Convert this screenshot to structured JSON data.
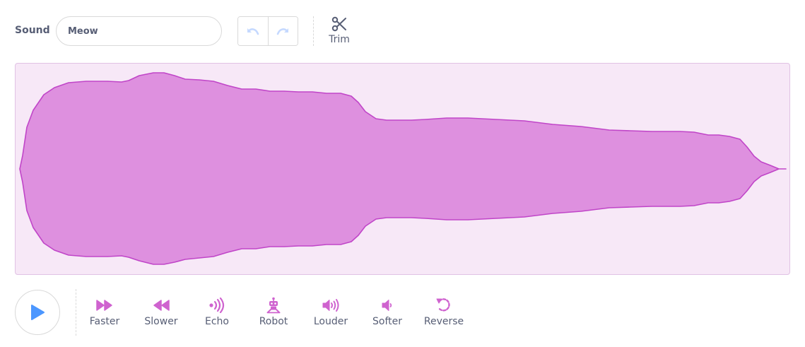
{
  "header": {
    "sound_label": "Sound",
    "sound_name": "Meow",
    "trim_label": "Trim"
  },
  "icons": {
    "undo": "undo-icon",
    "redo": "redo-icon",
    "trim": "scissors-icon",
    "play": "play-icon"
  },
  "effects": [
    {
      "label": "Faster",
      "icon": "fast-forward-icon"
    },
    {
      "label": "Slower",
      "icon": "rewind-icon"
    },
    {
      "label": "Echo",
      "icon": "echo-icon"
    },
    {
      "label": "Robot",
      "icon": "robot-icon"
    },
    {
      "label": "Louder",
      "icon": "louder-icon"
    },
    {
      "label": "Softer",
      "icon": "softer-icon"
    },
    {
      "label": "Reverse",
      "icon": "reverse-icon"
    }
  ],
  "colors": {
    "waveform_fill": "#de90df",
    "waveform_stroke": "#c045c8",
    "waveform_background": "#f7e8f7",
    "effect_icon": "#cf63cf",
    "play_icon": "#4c97ff",
    "disabled_icon": "#c5d9ff"
  }
}
